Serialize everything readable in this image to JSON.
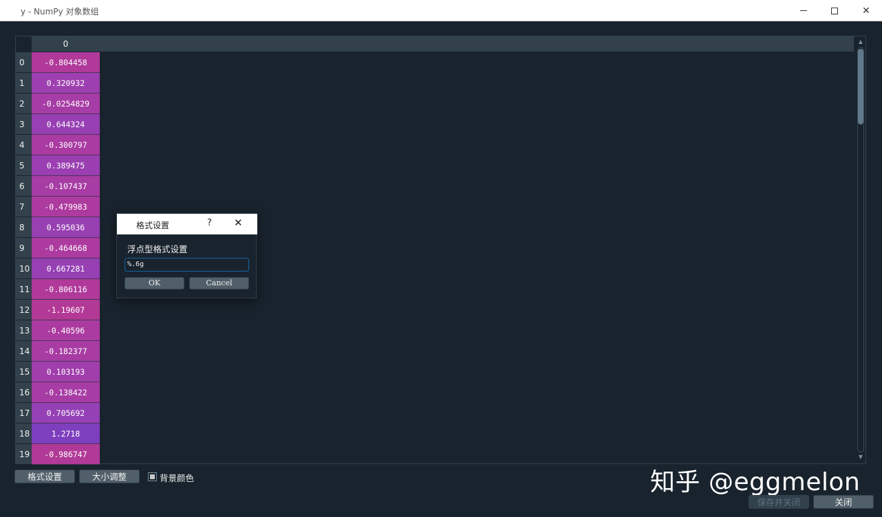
{
  "window": {
    "title": "y - NumPy 对象数组"
  },
  "window_controls": {
    "minimize": "—",
    "maximize": "☐",
    "close": "✕"
  },
  "table": {
    "column_header": "0",
    "rows": [
      {
        "index": "0",
        "value": "-0.804458",
        "color": "#b0399a"
      },
      {
        "index": "1",
        "value": "0.320932",
        "color": "#9d3fb0"
      },
      {
        "index": "2",
        "value": "-0.0254829",
        "color": "#a63ca5"
      },
      {
        "index": "3",
        "value": "0.644324",
        "color": "#973fb3"
      },
      {
        "index": "4",
        "value": "-0.300797",
        "color": "#a93ba2"
      },
      {
        "index": "5",
        "value": "0.389475",
        "color": "#9a3eb1"
      },
      {
        "index": "6",
        "value": "-0.107437",
        "color": "#a73ca4"
      },
      {
        "index": "7",
        "value": "-0.479983",
        "color": "#ad3a9e"
      },
      {
        "index": "8",
        "value": "0.595036",
        "color": "#983fb2"
      },
      {
        "index": "9",
        "value": "-0.464668",
        "color": "#ac3a9f"
      },
      {
        "index": "10",
        "value": "0.667281",
        "color": "#9640b4"
      },
      {
        "index": "11",
        "value": "-0.806116",
        "color": "#b0399a"
      },
      {
        "index": "12",
        "value": "-1.19607",
        "color": "#b23995"
      },
      {
        "index": "13",
        "value": "-0.40596",
        "color": "#ab3ba0"
      },
      {
        "index": "14",
        "value": "-0.182377",
        "color": "#a83ca3"
      },
      {
        "index": "15",
        "value": "0.103193",
        "color": "#a03eab"
      },
      {
        "index": "16",
        "value": "-0.138422",
        "color": "#a73ca4"
      },
      {
        "index": "17",
        "value": "0.705692",
        "color": "#9540b5"
      },
      {
        "index": "18",
        "value": "1.2718",
        "color": "#7e3fbf"
      },
      {
        "index": "19",
        "value": "-0.986747",
        "color": "#b13997"
      }
    ]
  },
  "toolbar": {
    "format_button": "格式设置",
    "resize_button": "大小调整",
    "bgcolor_label": "背景颜色",
    "bgcolor_checked": true,
    "save_close_button": "保存并关闭",
    "close_button": "关闭"
  },
  "watermark": "知乎 @eggmelon",
  "dialog": {
    "title": "格式设置",
    "help": "?",
    "close": "✕",
    "label": "浮点型格式设置",
    "input_value": "%.6g",
    "ok_button": "OK",
    "cancel_button": "Cancel"
  },
  "colors": {
    "background": "#19232d",
    "header": "#32414b",
    "button": "#505f69",
    "focus": "#1464a0"
  }
}
